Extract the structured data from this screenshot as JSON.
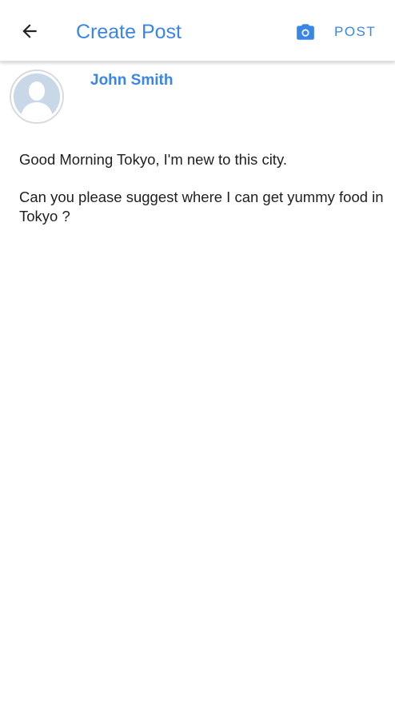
{
  "header": {
    "back_icon": "arrow-left-icon",
    "title": "Create Post",
    "camera_icon": "camera-icon",
    "post_label": "POST",
    "accent_color": "#3a86e6"
  },
  "author": {
    "avatar_icon": "default-user-avatar",
    "name": "John Smith"
  },
  "post": {
    "paragraphs": [
      "Good Morning Tokyo, I'm new to this city.",
      "Can you please suggest where I can get yummy food in Tokyo ?"
    ]
  }
}
